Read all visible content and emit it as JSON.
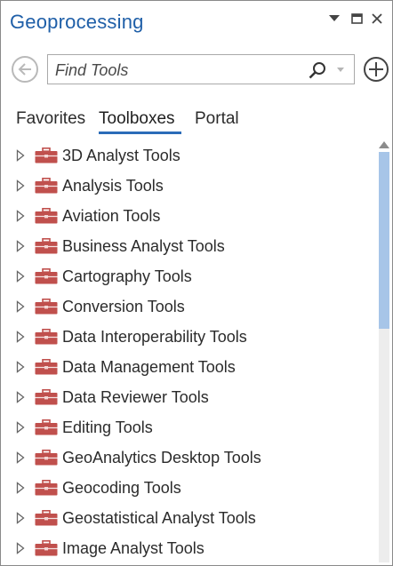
{
  "panel": {
    "title": "Geoprocessing",
    "title_color": "#1f5fa8"
  },
  "window_controls": {
    "dropdown_icon": "caret-down-icon",
    "maximize_icon": "restore-window-icon",
    "close_icon": "close-icon"
  },
  "search": {
    "placeholder": "Find Tools",
    "value": "",
    "icon": "search-icon",
    "dropdown_icon": "caret-down-icon"
  },
  "actions": {
    "back_icon": "back-arrow-icon",
    "add_icon": "add-circle-icon"
  },
  "tabs": [
    {
      "label": "Favorites",
      "active": false
    },
    {
      "label": "Toolboxes",
      "active": true
    },
    {
      "label": "Portal",
      "active": false
    }
  ],
  "accent_color": "#2b6cb8",
  "toolbox_icon_color": "#c0504d",
  "toolboxes": [
    {
      "label": "3D Analyst Tools"
    },
    {
      "label": "Analysis Tools"
    },
    {
      "label": "Aviation Tools"
    },
    {
      "label": "Business Analyst Tools"
    },
    {
      "label": "Cartography Tools"
    },
    {
      "label": "Conversion Tools"
    },
    {
      "label": "Data Interoperability Tools"
    },
    {
      "label": "Data Management Tools"
    },
    {
      "label": "Data Reviewer Tools"
    },
    {
      "label": "Editing Tools"
    },
    {
      "label": "GeoAnalytics Desktop Tools"
    },
    {
      "label": "Geocoding Tools"
    },
    {
      "label": "Geostatistical Analyst Tools"
    },
    {
      "label": "Image Analyst Tools"
    }
  ],
  "scrollbar": {
    "visible_fraction": 0.43,
    "position_fraction": 0.0
  }
}
